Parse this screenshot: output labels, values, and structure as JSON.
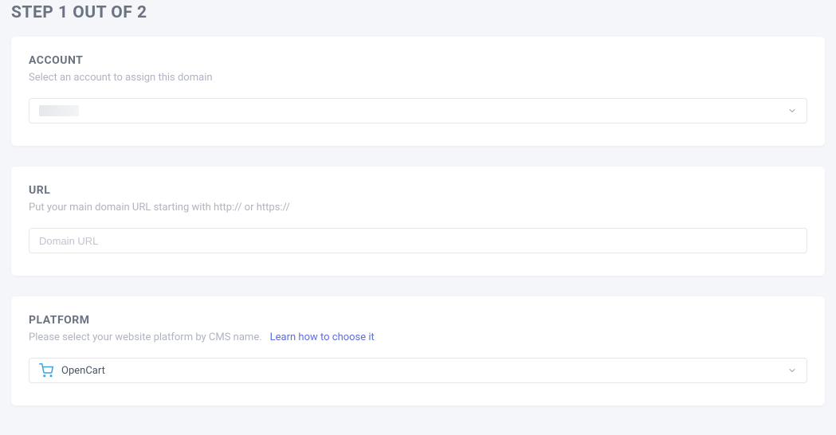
{
  "page_title": "STEP 1 OUT OF 2",
  "account": {
    "title": "ACCOUNT",
    "description": "Select an account to assign this domain",
    "selected_value": ""
  },
  "url": {
    "title": "URL",
    "description": "Put your main domain URL starting with http:// or https://",
    "placeholder": "Domain URL",
    "value": ""
  },
  "platform": {
    "title": "PLATFORM",
    "description": "Please select your website platform by CMS name.",
    "learn_link": "Learn how to choose it",
    "selected_value": "OpenCart"
  }
}
